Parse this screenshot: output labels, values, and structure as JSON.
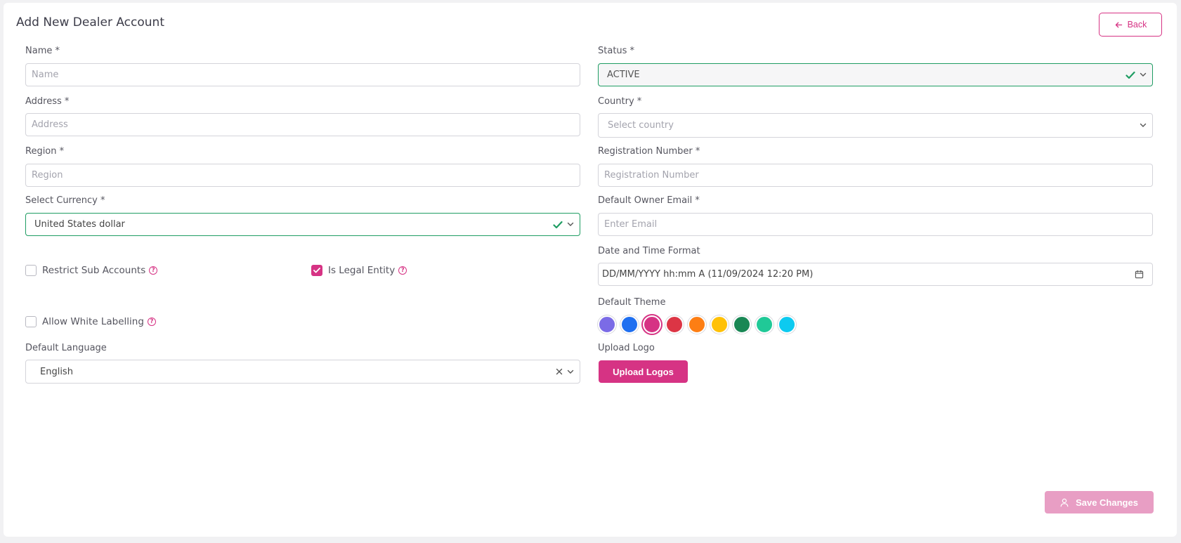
{
  "page": {
    "title": "Add New Dealer Account",
    "back_label": "Back"
  },
  "form": {
    "name": {
      "label": "Name *",
      "placeholder": "Name"
    },
    "status": {
      "label": "Status *",
      "value": "ACTIVE"
    },
    "address": {
      "label": "Address *",
      "placeholder": "Address"
    },
    "country": {
      "label": "Country *",
      "placeholder": "Select country"
    },
    "region": {
      "label": "Region *",
      "placeholder": "Region"
    },
    "registration": {
      "label": "Registration Number *",
      "placeholder": "Registration Number"
    },
    "currency": {
      "label": "Select Currency *",
      "value": "United States dollar"
    },
    "owner_email": {
      "label": "Default Owner Email *",
      "placeholder": "Enter Email"
    },
    "date_format": {
      "label": "Date and Time Format",
      "value": "DD/MM/YYYY hh:mm A (11/09/2024 12:20 PM)"
    },
    "restrict_sub_accounts": {
      "label": "Restrict Sub Accounts",
      "checked": false
    },
    "is_legal_entity": {
      "label": "Is Legal Entity",
      "checked": true
    },
    "allow_white_labelling": {
      "label": "Allow White Labelling",
      "checked": false
    },
    "theme": {
      "label": "Default Theme",
      "colors": [
        "#7b6be6",
        "#1f6ff0",
        "#d63384",
        "#dc3545",
        "#fd7e14",
        "#ffc107",
        "#198754",
        "#20c997",
        "#0dcaf0"
      ],
      "selected_index": 2
    },
    "language": {
      "label": "Default Language",
      "value": "English"
    },
    "logo": {
      "label": "Upload Logo",
      "button_label": "Upload Logos"
    }
  },
  "actions": {
    "save_label": "Save Changes"
  },
  "colors": {
    "accent": "#d63384",
    "valid": "#1f9d63",
    "save_disabled": "#e89ec4"
  }
}
